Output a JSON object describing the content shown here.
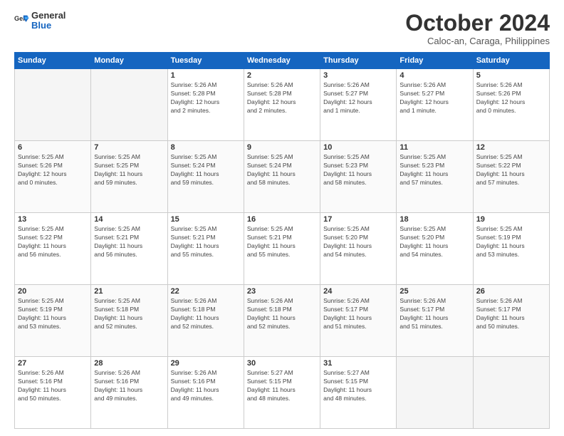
{
  "header": {
    "logo_line1": "General",
    "logo_line2": "Blue",
    "month": "October 2024",
    "location": "Caloc-an, Caraga, Philippines"
  },
  "days_of_week": [
    "Sunday",
    "Monday",
    "Tuesday",
    "Wednesday",
    "Thursday",
    "Friday",
    "Saturday"
  ],
  "weeks": [
    [
      {
        "day": "",
        "info": ""
      },
      {
        "day": "",
        "info": ""
      },
      {
        "day": "1",
        "info": "Sunrise: 5:26 AM\nSunset: 5:28 PM\nDaylight: 12 hours\nand 2 minutes."
      },
      {
        "day": "2",
        "info": "Sunrise: 5:26 AM\nSunset: 5:28 PM\nDaylight: 12 hours\nand 2 minutes."
      },
      {
        "day": "3",
        "info": "Sunrise: 5:26 AM\nSunset: 5:27 PM\nDaylight: 12 hours\nand 1 minute."
      },
      {
        "day": "4",
        "info": "Sunrise: 5:26 AM\nSunset: 5:27 PM\nDaylight: 12 hours\nand 1 minute."
      },
      {
        "day": "5",
        "info": "Sunrise: 5:26 AM\nSunset: 5:26 PM\nDaylight: 12 hours\nand 0 minutes."
      }
    ],
    [
      {
        "day": "6",
        "info": "Sunrise: 5:25 AM\nSunset: 5:26 PM\nDaylight: 12 hours\nand 0 minutes."
      },
      {
        "day": "7",
        "info": "Sunrise: 5:25 AM\nSunset: 5:25 PM\nDaylight: 11 hours\nand 59 minutes."
      },
      {
        "day": "8",
        "info": "Sunrise: 5:25 AM\nSunset: 5:24 PM\nDaylight: 11 hours\nand 59 minutes."
      },
      {
        "day": "9",
        "info": "Sunrise: 5:25 AM\nSunset: 5:24 PM\nDaylight: 11 hours\nand 58 minutes."
      },
      {
        "day": "10",
        "info": "Sunrise: 5:25 AM\nSunset: 5:23 PM\nDaylight: 11 hours\nand 58 minutes."
      },
      {
        "day": "11",
        "info": "Sunrise: 5:25 AM\nSunset: 5:23 PM\nDaylight: 11 hours\nand 57 minutes."
      },
      {
        "day": "12",
        "info": "Sunrise: 5:25 AM\nSunset: 5:22 PM\nDaylight: 11 hours\nand 57 minutes."
      }
    ],
    [
      {
        "day": "13",
        "info": "Sunrise: 5:25 AM\nSunset: 5:22 PM\nDaylight: 11 hours\nand 56 minutes."
      },
      {
        "day": "14",
        "info": "Sunrise: 5:25 AM\nSunset: 5:21 PM\nDaylight: 11 hours\nand 56 minutes."
      },
      {
        "day": "15",
        "info": "Sunrise: 5:25 AM\nSunset: 5:21 PM\nDaylight: 11 hours\nand 55 minutes."
      },
      {
        "day": "16",
        "info": "Sunrise: 5:25 AM\nSunset: 5:21 PM\nDaylight: 11 hours\nand 55 minutes."
      },
      {
        "day": "17",
        "info": "Sunrise: 5:25 AM\nSunset: 5:20 PM\nDaylight: 11 hours\nand 54 minutes."
      },
      {
        "day": "18",
        "info": "Sunrise: 5:25 AM\nSunset: 5:20 PM\nDaylight: 11 hours\nand 54 minutes."
      },
      {
        "day": "19",
        "info": "Sunrise: 5:25 AM\nSunset: 5:19 PM\nDaylight: 11 hours\nand 53 minutes."
      }
    ],
    [
      {
        "day": "20",
        "info": "Sunrise: 5:25 AM\nSunset: 5:19 PM\nDaylight: 11 hours\nand 53 minutes."
      },
      {
        "day": "21",
        "info": "Sunrise: 5:25 AM\nSunset: 5:18 PM\nDaylight: 11 hours\nand 52 minutes."
      },
      {
        "day": "22",
        "info": "Sunrise: 5:26 AM\nSunset: 5:18 PM\nDaylight: 11 hours\nand 52 minutes."
      },
      {
        "day": "23",
        "info": "Sunrise: 5:26 AM\nSunset: 5:18 PM\nDaylight: 11 hours\nand 52 minutes."
      },
      {
        "day": "24",
        "info": "Sunrise: 5:26 AM\nSunset: 5:17 PM\nDaylight: 11 hours\nand 51 minutes."
      },
      {
        "day": "25",
        "info": "Sunrise: 5:26 AM\nSunset: 5:17 PM\nDaylight: 11 hours\nand 51 minutes."
      },
      {
        "day": "26",
        "info": "Sunrise: 5:26 AM\nSunset: 5:17 PM\nDaylight: 11 hours\nand 50 minutes."
      }
    ],
    [
      {
        "day": "27",
        "info": "Sunrise: 5:26 AM\nSunset: 5:16 PM\nDaylight: 11 hours\nand 50 minutes."
      },
      {
        "day": "28",
        "info": "Sunrise: 5:26 AM\nSunset: 5:16 PM\nDaylight: 11 hours\nand 49 minutes."
      },
      {
        "day": "29",
        "info": "Sunrise: 5:26 AM\nSunset: 5:16 PM\nDaylight: 11 hours\nand 49 minutes."
      },
      {
        "day": "30",
        "info": "Sunrise: 5:27 AM\nSunset: 5:15 PM\nDaylight: 11 hours\nand 48 minutes."
      },
      {
        "day": "31",
        "info": "Sunrise: 5:27 AM\nSunset: 5:15 PM\nDaylight: 11 hours\nand 48 minutes."
      },
      {
        "day": "",
        "info": ""
      },
      {
        "day": "",
        "info": ""
      }
    ]
  ]
}
